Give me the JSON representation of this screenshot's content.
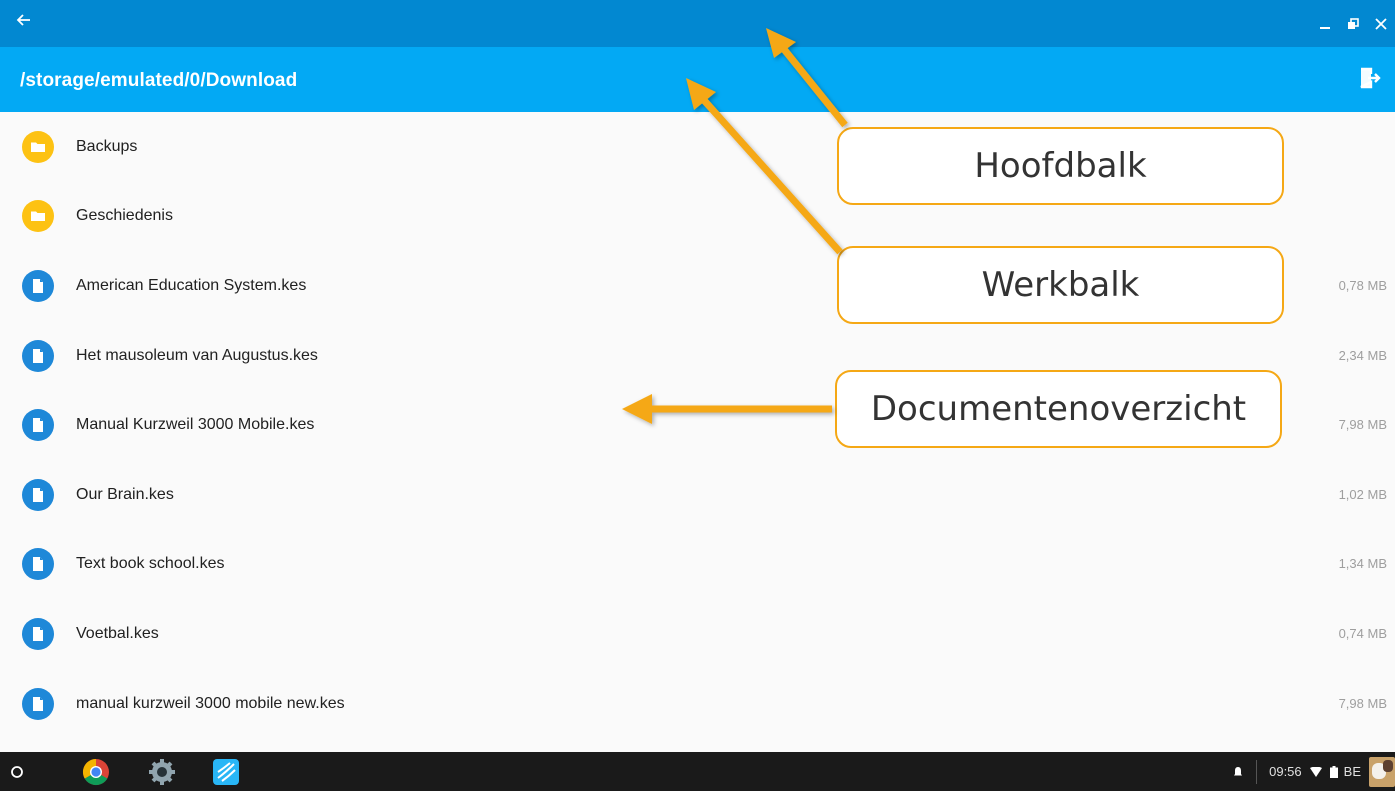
{
  "window": {
    "back_icon": "arrow-left-icon",
    "controls": [
      "minimize-icon",
      "restore-icon",
      "close-icon"
    ]
  },
  "toolbar": {
    "path": "/storage/emulated/0/Download",
    "exit_icon": "exit-icon"
  },
  "files": [
    {
      "type": "folder",
      "name": "Backups",
      "size": ""
    },
    {
      "type": "folder",
      "name": "Geschiedenis",
      "size": ""
    },
    {
      "type": "file",
      "name": "American Education System.kes",
      "size": "0,78 MB"
    },
    {
      "type": "file",
      "name": "Het mausoleum van Augustus.kes",
      "size": "2,34 MB"
    },
    {
      "type": "file",
      "name": "Manual Kurzweil 3000 Mobile.kes",
      "size": "7,98 MB"
    },
    {
      "type": "file",
      "name": "Our Brain.kes",
      "size": "1,02 MB"
    },
    {
      "type": "file",
      "name": "Text book school.kes",
      "size": "1,34 MB"
    },
    {
      "type": "file",
      "name": "Voetbal.kes",
      "size": "0,74 MB"
    },
    {
      "type": "file",
      "name": "manual kurzweil 3000 mobile new.kes",
      "size": "7,98 MB"
    }
  ],
  "callouts": {
    "hoofdbalk": "Hoofdbalk",
    "werkbalk": "Werkbalk",
    "documentenoverzicht": "Documentenoverzicht"
  },
  "shelf": {
    "apps": [
      "launcher-icon",
      "chrome-icon",
      "settings-icon",
      "kurzweil-icon"
    ],
    "time": "09:56",
    "locale": "BE"
  },
  "colors": {
    "titlebar": "#0288d1",
    "toolbar": "#03a9f4",
    "folder": "#fdc213",
    "file": "#1e88d8",
    "callout_border": "#f5a815"
  }
}
